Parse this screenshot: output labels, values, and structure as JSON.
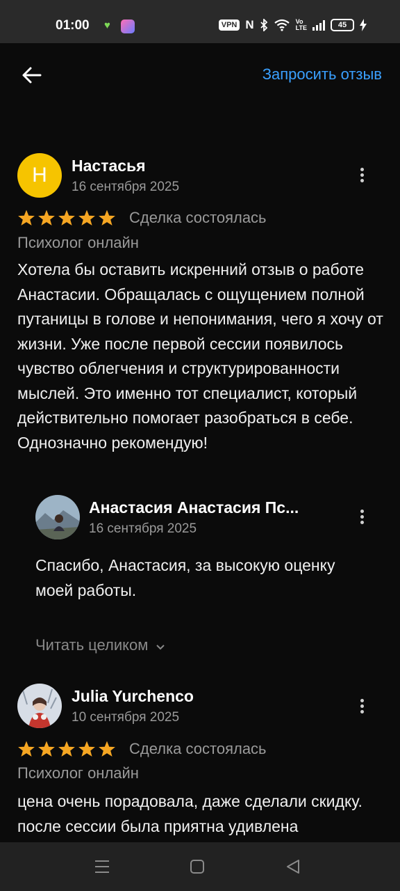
{
  "status_bar": {
    "time": "01:00",
    "vpn_label": "VPN",
    "battery": "45",
    "icons": [
      "heart-icon",
      "app-icon",
      "nfc-icon",
      "bluetooth-icon",
      "wifi-icon",
      "volte-icon",
      "signal-icon",
      "battery-icon",
      "charging-icon"
    ]
  },
  "header": {
    "back_icon": "arrow-left-icon",
    "request_review_label": "Запросить отзыв"
  },
  "reviews": [
    {
      "avatar_letter": "Н",
      "author": "Настасья",
      "date": "16 сентября 2025",
      "rating": 5,
      "deal_status": "Сделка состоялась",
      "service": "Психолог онлайн",
      "text": "Хотела бы оставить искренний отзыв о работе Анастасии. Обращалась с ощущением полной путаницы в голове и непонимания, чего я хочу от жизни. Уже после первой сессии появилось чувство облегчения и структурированности мыслей. Это именно тот специалист, который действительно помогает разобраться в себе. Однозначно рекомендую!",
      "reply": {
        "author": "Анастасия Анастасия Пс...",
        "date": "16 сентября 2025",
        "text": "Спасибо, Анастасия, за высокую оценку моей работы."
      },
      "read_more_label": "Читать целиком"
    },
    {
      "author": "Julia Yurchenco",
      "date": "10 сентября 2025",
      "rating": 5,
      "deal_status": "Сделка состоялась",
      "service": "Психолог онлайн",
      "text": "цена очень порадовала, даже сделали скидку. после сессии была приятна удивлена"
    }
  ],
  "colors": {
    "accent": "#3aa0ff",
    "star": "#f5a623",
    "avatar_letter_bg": "#f6c400",
    "background": "#0b0b0b"
  },
  "nav_bar": {
    "icons": [
      "menu-icon",
      "home-icon",
      "back-triangle-icon"
    ]
  }
}
